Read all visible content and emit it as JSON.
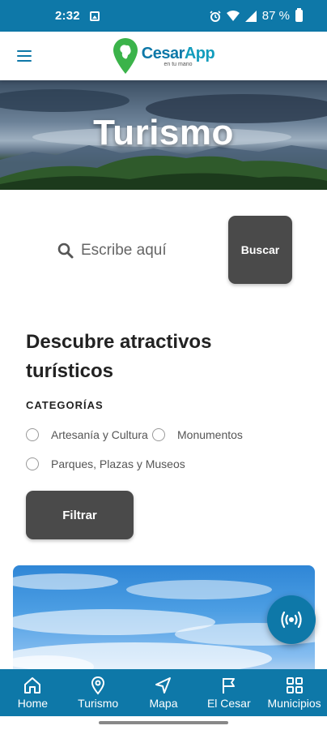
{
  "status_bar": {
    "time": "2:32",
    "battery_text": "87 %",
    "icons": [
      "image-icon",
      "alarm-icon",
      "wifi-icon",
      "signal-icon",
      "battery-icon"
    ]
  },
  "header": {
    "logo_name": "CesarApp",
    "logo_name_part1": "Cesar",
    "logo_name_part2": "App",
    "logo_tagline": "en tu mano",
    "menu_icon": "hamburger-menu-icon",
    "brand_color": "#0e78a8"
  },
  "hero": {
    "title": "Turismo"
  },
  "search": {
    "placeholder": "Escribe aquí",
    "button_label": "Buscar",
    "icon": "search-icon"
  },
  "discover": {
    "title": "Descubre atractivos turísticos",
    "categories_label": "CATEGORÍAS",
    "categories": [
      {
        "label": "Artesanía y Cultura",
        "checked": false
      },
      {
        "label": "Monumentos",
        "checked": false
      },
      {
        "label": "Parques, Plazas y Museos",
        "checked": false
      }
    ],
    "filter_button_label": "Filtrar"
  },
  "fab": {
    "icon": "broadcast-icon"
  },
  "bottom_nav": {
    "items": [
      {
        "label": "Home",
        "icon": "home-icon"
      },
      {
        "label": "Turismo",
        "icon": "location-pin-icon"
      },
      {
        "label": "Mapa",
        "icon": "navigation-arrow-icon"
      },
      {
        "label": "El Cesar",
        "icon": "flag-icon"
      },
      {
        "label": "Municipios",
        "icon": "grid-icon"
      }
    ]
  },
  "colors": {
    "primary": "#0e78a8",
    "button_dark": "#4a4a4a",
    "text_dark": "#222222"
  }
}
